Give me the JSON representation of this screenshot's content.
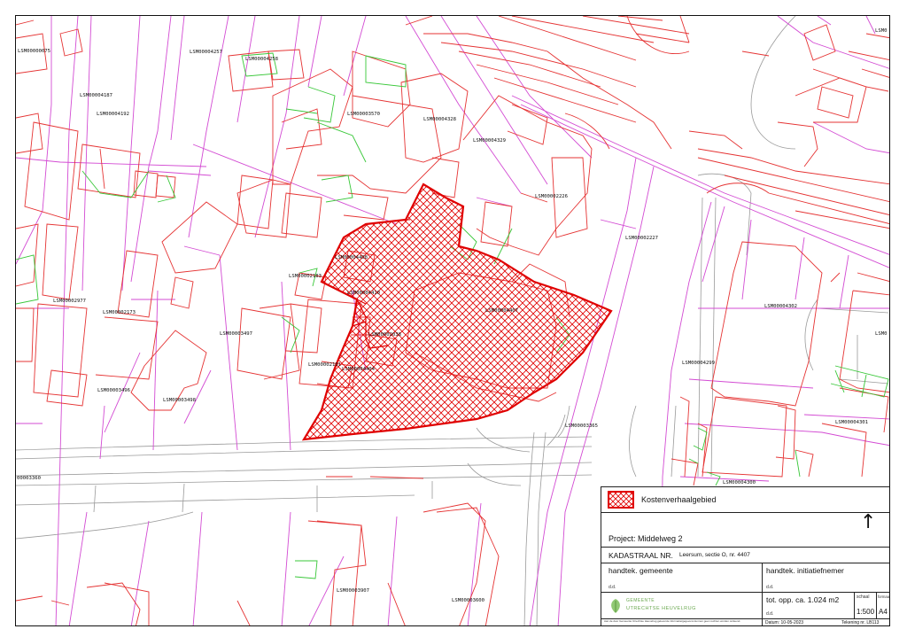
{
  "map": {
    "labels": [
      {
        "text": "LSM00000075"
      },
      {
        "text": "LSM00004257"
      },
      {
        "text": "LSM00004258"
      },
      {
        "text": "LSM00004187"
      },
      {
        "text": "LSM00004192"
      },
      {
        "text": "LSM00003570"
      },
      {
        "text": "LSM00004328"
      },
      {
        "text": "LSM00004329"
      },
      {
        "text": "LSM00002226"
      },
      {
        "text": "LSM00002227"
      },
      {
        "text": "LSM00004408"
      },
      {
        "text": "LSM00002183"
      },
      {
        "text": "LSM00004410"
      },
      {
        "text": "LSM00004407"
      },
      {
        "text": "LSM00002977"
      },
      {
        "text": "LSM00002173"
      },
      {
        "text": "LSM00003497"
      },
      {
        "text": "LSM00002038"
      },
      {
        "text": "LSM00002101"
      },
      {
        "text": "LSM00004404"
      },
      {
        "text": "LSM00003496"
      },
      {
        "text": "LSM00003498"
      },
      {
        "text": "LSM00003365"
      },
      {
        "text": "LSM00004302"
      },
      {
        "text": "LSM00004299"
      },
      {
        "text": "LSM00004301"
      },
      {
        "text": "LSM00004300"
      },
      {
        "text": "LSM00003907"
      },
      {
        "text": "LSM00003600"
      },
      {
        "text": "00003360"
      },
      {
        "text": "LSM0"
      },
      {
        "text": "LSM0"
      }
    ]
  },
  "legend": {
    "label": "Kostenverhaalgebied",
    "colors": {
      "hatch": "#e00000",
      "parcel_boundary": "#e53333",
      "administrative_line": "#d34bd3",
      "building_annex": "#38c738"
    }
  },
  "titleblock": {
    "project": "Project: Middelweg 2",
    "kadastraal_label": "KADASTRAAL NR.",
    "kadastraal_value": "Leersum, sectie O, nr. 4407",
    "sign_municipality": "handtek. gemeente",
    "sign_initiator": "handtek. initiatiefnemer",
    "sign_municipality_sub": "d.d.",
    "sign_initiator_sub": "d.d.",
    "org_line1": "GEMEENTE",
    "org_line2": "UTRECHTSE HEUVELRUG",
    "area": "tot. opp. ca. 1.024  m2",
    "area_sub": "d.d.",
    "scale_label": "schaal",
    "scale": "1:500",
    "format_label": "formaat",
    "format": "A4",
    "date": "Datum: 10-05-2023",
    "drawing_no": "Tekening nr. LB113",
    "disclaimer": "Aan de door Gemeente Utrechtse Heuvelrug geleverde informatie/gegevens kunnen geen rechten worden ontleend.",
    "north_symbol": "↑"
  }
}
